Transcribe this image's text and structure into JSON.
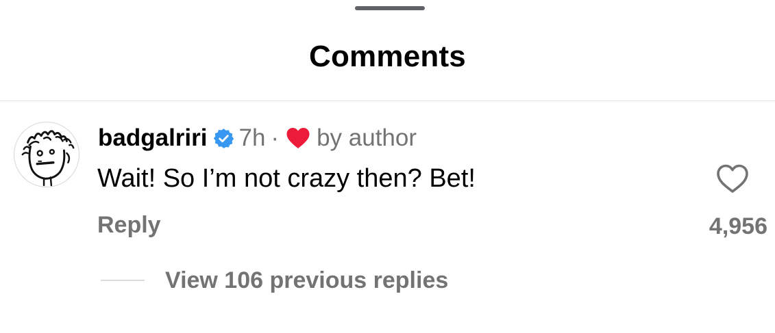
{
  "header": {
    "title": "Comments"
  },
  "comment": {
    "username": "badgalriri",
    "verified": true,
    "time": "7h",
    "separator": "·",
    "liked_by_author_label": "by author",
    "text": "Wait! So I’m not crazy then? Bet!",
    "reply_label": "Reply",
    "like_count": "4,956",
    "view_replies_label": "View 106 previous replies"
  },
  "colors": {
    "verified_badge": "#3897f0",
    "author_heart": "#ed1b3a",
    "secondary_text": "#737373",
    "handle": "#5f6368"
  },
  "icons": {
    "verified": "verified-badge-icon",
    "author_heart": "heart-filled-icon",
    "like": "heart-outline-icon",
    "avatar": "avatar-doodle"
  }
}
